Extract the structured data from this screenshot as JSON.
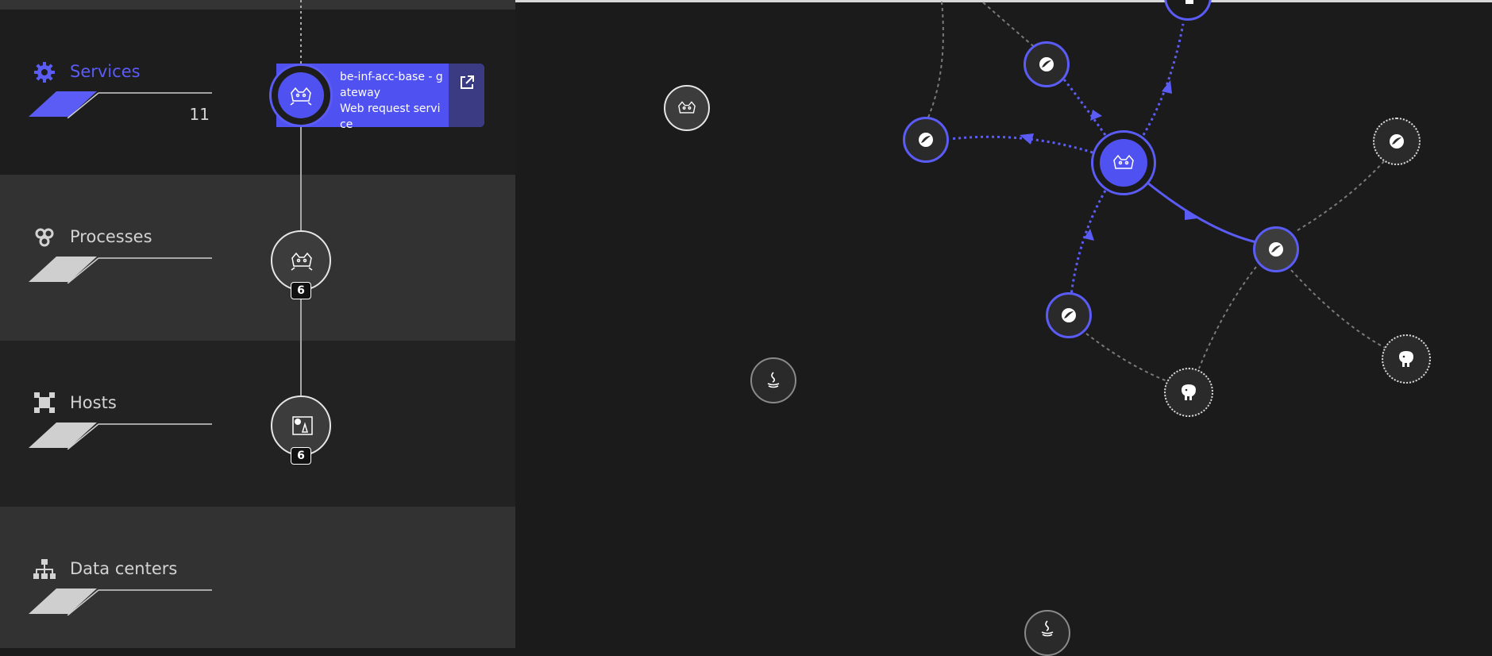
{
  "layers": [
    {
      "label": "Services",
      "count": "11",
      "icon": "gear-icon",
      "accent": "#5b5cf6"
    },
    {
      "label": "Processes",
      "icon": "process-icon"
    },
    {
      "label": "Hosts",
      "icon": "host-icon"
    },
    {
      "label": "Data centers",
      "icon": "datacenter-icon"
    }
  ],
  "selected_service": {
    "name": "be-inf-acc-base - gateway",
    "type": "Web request service",
    "icon": "tomcat-icon"
  },
  "process_node": {
    "count": "6",
    "icon": "tomcat-icon"
  },
  "host_node": {
    "count": "6",
    "icon": "linux-host-icon"
  },
  "colors": {
    "accent": "#5b5cf6",
    "background": "#1b1b1b",
    "label": "#d3d3d3"
  }
}
